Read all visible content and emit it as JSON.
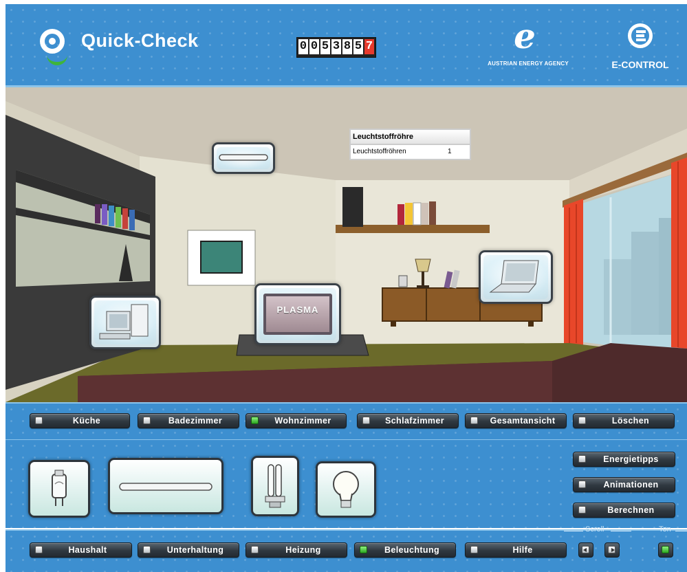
{
  "header": {
    "app_name": "Quick-Check",
    "counter_digits": [
      "0",
      "0",
      "5",
      "3",
      "8",
      "5",
      "7"
    ],
    "partner_logo_1_text": "AUSTRIAN ENERGY AGENCY",
    "partner_logo_2_text": "E-CONTROL"
  },
  "scene": {
    "popup": {
      "title": "Leuchtstoffröhre",
      "item": "Leuchtstoffröhren",
      "count": "1"
    },
    "device_labels": {
      "plasma": "PLASMA"
    },
    "devices": [
      "computer-icon",
      "plasma-tv-icon",
      "laptop-icon",
      "fluorescent-tube-icon"
    ]
  },
  "rooms": [
    {
      "label": "Küche",
      "active": false
    },
    {
      "label": "Badezimmer",
      "active": false
    },
    {
      "label": "Wohnzimmer",
      "active": true
    },
    {
      "label": "Schlafzimmer",
      "active": false
    },
    {
      "label": "Gesamtansicht",
      "active": false
    },
    {
      "label": "Löschen",
      "active": false
    }
  ],
  "devices_bar": {
    "items": [
      "halogen-bulb-icon",
      "fluorescent-tube-icon",
      "energy-saving-bulb-icon",
      "incandescent-bulb-icon"
    ]
  },
  "side_actions": [
    {
      "label": "Energietipps"
    },
    {
      "label": "Animationen"
    },
    {
      "label": "Berechnen"
    }
  ],
  "categories": [
    {
      "label": "Haushalt",
      "active": false
    },
    {
      "label": "Unterhaltung",
      "active": false
    },
    {
      "label": "Heizung",
      "active": false
    },
    {
      "label": "Beleuchtung",
      "active": true
    },
    {
      "label": "Hilfe",
      "active": false
    }
  ],
  "controls": {
    "scroll_label": "Scroll",
    "sound_label": "Ton",
    "sound_on": true
  },
  "colors": {
    "panel_blue": "#3d8fd0",
    "led_active": "#2aa720",
    "button_dark": "#2f3840",
    "curtain": "#e8472a"
  }
}
